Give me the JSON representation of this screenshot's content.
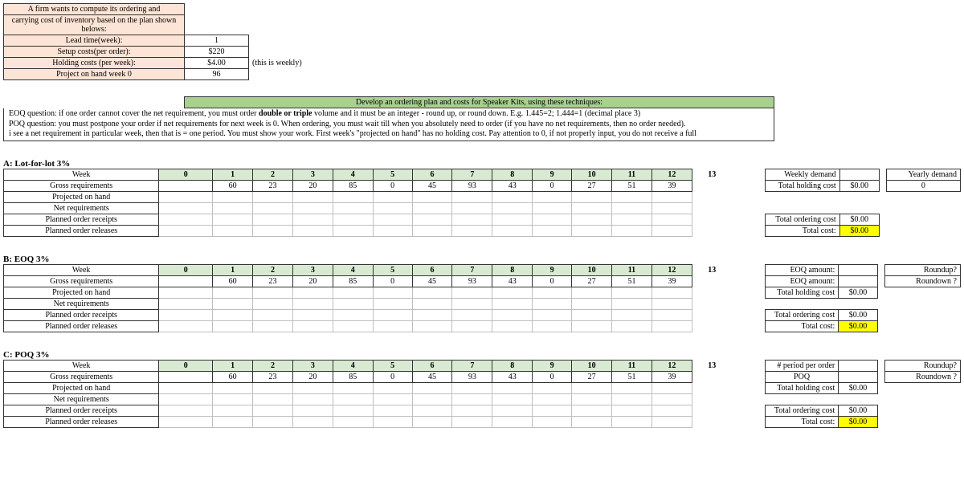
{
  "params": {
    "title": "A firm wants to compute its ordering and",
    "subtitle": "carrying cost of inventory based on the plan shown belows:",
    "rows": [
      {
        "label": "Lead time(week):",
        "val": "1",
        "note": ""
      },
      {
        "label": "Setup costs(per order):",
        "val": "$220",
        "note": ""
      },
      {
        "label": "Holding costs (per week):",
        "val": "$4.00",
        "note": "(this is weekly)"
      },
      {
        "label": "Project on hand week 0",
        "val": "96",
        "note": ""
      }
    ]
  },
  "banner": "Develop an ordering plan and costs for Speaker Kits, using these techniques:",
  "instr": {
    "l1a": "EOQ question: if one order cannot cover the net requirement, you must order ",
    "l1b": "double or triple",
    "l1c": " volume and it must be an integer - round up, or round down. E.g. 1.445=2; 1.444=1 (decimal place 3)",
    "l2": "POQ question: you must postpone your order if net requirements for next week is 0. When ordering, you must wait till when you absolutely need to order (if you have no net requirements, then no order needed).",
    "l3": "i see a net requirement in particular week, then that is = one period. You must show your work. First week's \"projected on hand\" has no holding cost. Pay attention to 0, if not properly input, you do not receive a full"
  },
  "weeks_hdr": "Week",
  "weeks": [
    "0",
    "1",
    "2",
    "3",
    "4",
    "5",
    "6",
    "7",
    "8",
    "9",
    "10",
    "11",
    "12",
    "13"
  ],
  "gross_label": "Gross requirements",
  "gross": [
    "",
    "60",
    "23",
    "20",
    "85",
    "0",
    "45",
    "93",
    "43",
    "0",
    "27",
    "51",
    "39",
    ""
  ],
  "row_labels": [
    "Projected on hand",
    "Net requirements",
    "Planned order receipts",
    "Planned order releases"
  ],
  "secA": "A: Lot-for-lot 3%",
  "secB": "B: EOQ 3%",
  "secC": "C: POQ 3%",
  "sideA": {
    "r0a": "Weekly demand",
    "r0c": "Yearly demand",
    "r0d": "0",
    "r1a": "Total holding cost",
    "r1b": "$0.00",
    "r2a": "Total ordering cost",
    "r2b": "$0.00",
    "r3a": "Total cost:",
    "r3b": "$0.00"
  },
  "sideB": {
    "r0a": "EOQ amount:",
    "r0c": "Roundup?",
    "r1a": "EOQ amount:",
    "r1c": "Roundown ?",
    "r2a": "Total holding cost",
    "r2b": "$0.00",
    "r3a": "Total ordering cost",
    "r3b": "$0.00",
    "r4a": "Total cost:",
    "r4b": "$0.00"
  },
  "sideC": {
    "r0a": "# period per order",
    "r0c": "Roundup?",
    "r1a": "POQ",
    "r1c": "Roundown ?",
    "r2a": "Total holding cost",
    "r2b": "$0.00",
    "r3a": "Total ordering cost",
    "r3b": "$0.00",
    "r4a": "Total cost:",
    "r4b": "$0.00"
  }
}
